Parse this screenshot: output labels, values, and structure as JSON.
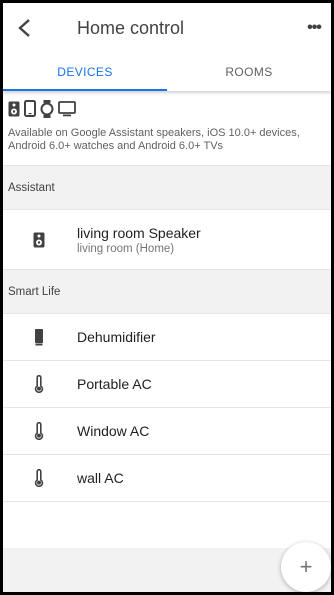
{
  "header": {
    "title": "Home control",
    "back_icon": "arrow-back-icon",
    "menu_icon": "more-horizontal-icon",
    "menu_glyph": "•••"
  },
  "tabs": [
    {
      "label": "DEVICES",
      "active": true
    },
    {
      "label": "ROOMS",
      "active": false
    }
  ],
  "info": {
    "icons": [
      "speaker-icon",
      "phone-icon",
      "watch-icon",
      "tv-icon"
    ],
    "text": "Available on Google Assistant speakers, iOS 10.0+ devices, Android 6.0+ watches and Android 6.0+ TVs"
  },
  "sections": {
    "assistant": {
      "title": "Assistant",
      "items": [
        {
          "name": "living room Speaker",
          "sub": "living room (Home)",
          "icon": "speaker-icon"
        }
      ]
    },
    "smart_life": {
      "title": "Smart Life",
      "items": [
        {
          "name": "Dehumidifier",
          "icon": "dehumidifier-icon"
        },
        {
          "name": "Portable AC",
          "icon": "thermometer-icon"
        },
        {
          "name": "Window AC",
          "icon": "thermometer-icon"
        },
        {
          "name": "wall AC",
          "icon": "thermometer-icon"
        }
      ]
    }
  },
  "fab": {
    "glyph": "+",
    "icon": "add-icon"
  },
  "colors": {
    "accent": "#1a73e8",
    "section_bg": "#f2f2f2",
    "icon": "#424242"
  }
}
